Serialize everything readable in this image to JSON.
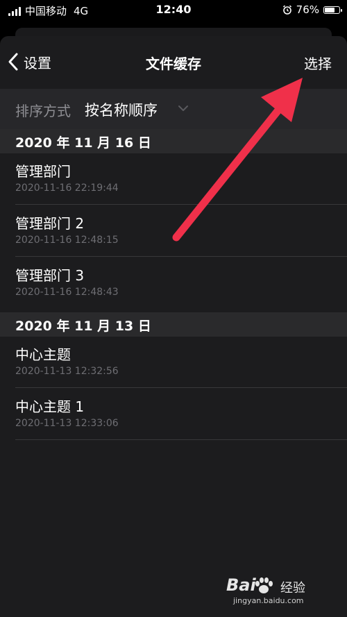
{
  "status_bar": {
    "carrier": "中国移动",
    "network": "4G",
    "time": "12:40",
    "battery": "76%",
    "battery_level": 0.76
  },
  "nav": {
    "back_label": "设置",
    "title": "文件缓存",
    "action_label": "选择"
  },
  "sort": {
    "label": "排序方式",
    "value": "按名称顺序"
  },
  "sections": [
    {
      "header": "2020 年 11 月 16 日",
      "items": [
        {
          "title": "管理部门",
          "time": "2020-11-16 22:19:44"
        },
        {
          "title": "管理部门 2",
          "time": "2020-11-16 12:48:15"
        },
        {
          "title": "管理部门 3",
          "time": "2020-11-16 12:48:43"
        }
      ]
    },
    {
      "header": "2020 年 11 月 13 日",
      "items": [
        {
          "title": "中心主题",
          "time": "2020-11-13 12:32:56"
        },
        {
          "title": "中心主题 1",
          "time": "2020-11-13 12:33:06"
        }
      ]
    }
  ],
  "watermark": {
    "logo": "Bai",
    "text": "经验",
    "url": "jingyan.baidu.com"
  },
  "colors": {
    "annotation_arrow": "#f0304a",
    "sheet_bg": "#1c1c1e",
    "section_bg": "#2a2a2c"
  }
}
